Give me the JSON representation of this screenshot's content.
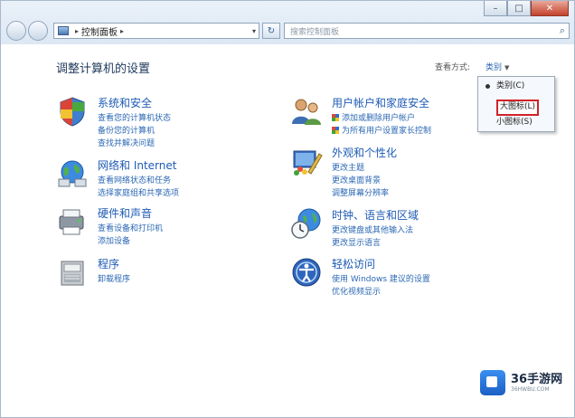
{
  "window": {
    "caption_buttons": {
      "minimize": "–",
      "maximize": "□",
      "close": "✕"
    }
  },
  "navigation": {
    "address": {
      "segment": "控制面板"
    },
    "search": {
      "placeholder": "搜索控制面板"
    }
  },
  "page": {
    "title": "调整计算机的设置",
    "view_by_label": "查看方式:",
    "view_by_value": "类别"
  },
  "view_menu": {
    "items": [
      "类别(C)",
      "大图标(L)",
      "小图标(S)"
    ],
    "selected_index": 0,
    "highlighted_index": 1,
    "highlight_color": "#d0222a"
  },
  "categories": [
    {
      "icon": "system-security-icon",
      "title": "系统和安全",
      "links": [
        "查看您的计算机状态",
        "备份您的计算机",
        "查找并解决问题"
      ]
    },
    {
      "icon": "network-internet-icon",
      "title": "网络和 Internet",
      "links": [
        "查看网络状态和任务",
        "选择家庭组和共享选项"
      ]
    },
    {
      "icon": "hardware-sound-icon",
      "title": "硬件和声音",
      "links": [
        "查看设备和打印机",
        "添加设备"
      ]
    },
    {
      "icon": "programs-icon",
      "title": "程序",
      "links": [
        "卸载程序"
      ]
    },
    {
      "icon": "user-accounts-icon",
      "title": "用户帐户和家庭安全",
      "links": [
        "添加或删除用户帐户",
        "为所有用户设置家长控制"
      ]
    },
    {
      "icon": "appearance-icon",
      "title": "外观和个性化",
      "links": [
        "更改主题",
        "更改桌面背景",
        "调整屏幕分辨率"
      ]
    },
    {
      "icon": "clock-region-icon",
      "title": "时钟、语言和区域",
      "links": [
        "更改键盘或其他输入法",
        "更改显示语言"
      ]
    },
    {
      "icon": "ease-of-access-icon",
      "title": "轻松访问",
      "links": [
        "使用 Windows 建议的设置",
        "优化视频显示"
      ]
    }
  ],
  "watermark": {
    "name": "36手游网",
    "url": "36HWBU.COM"
  },
  "colors": {
    "link": "#2c68b4",
    "title": "#1e5bb5",
    "heading": "#1e395b"
  }
}
